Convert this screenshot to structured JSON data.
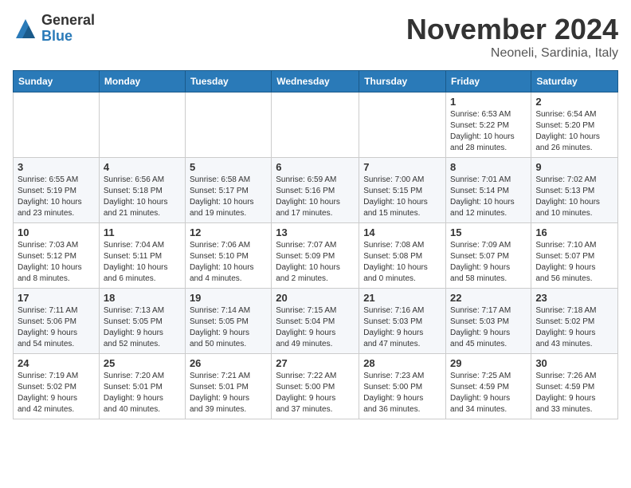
{
  "logo": {
    "general": "General",
    "blue": "Blue"
  },
  "title": "November 2024",
  "location": "Neoneli, Sardinia, Italy",
  "weekdays": [
    "Sunday",
    "Monday",
    "Tuesday",
    "Wednesday",
    "Thursday",
    "Friday",
    "Saturday"
  ],
  "weeks": [
    [
      {
        "day": "",
        "info": ""
      },
      {
        "day": "",
        "info": ""
      },
      {
        "day": "",
        "info": ""
      },
      {
        "day": "",
        "info": ""
      },
      {
        "day": "",
        "info": ""
      },
      {
        "day": "1",
        "info": "Sunrise: 6:53 AM\nSunset: 5:22 PM\nDaylight: 10 hours\nand 28 minutes."
      },
      {
        "day": "2",
        "info": "Sunrise: 6:54 AM\nSunset: 5:20 PM\nDaylight: 10 hours\nand 26 minutes."
      }
    ],
    [
      {
        "day": "3",
        "info": "Sunrise: 6:55 AM\nSunset: 5:19 PM\nDaylight: 10 hours\nand 23 minutes."
      },
      {
        "day": "4",
        "info": "Sunrise: 6:56 AM\nSunset: 5:18 PM\nDaylight: 10 hours\nand 21 minutes."
      },
      {
        "day": "5",
        "info": "Sunrise: 6:58 AM\nSunset: 5:17 PM\nDaylight: 10 hours\nand 19 minutes."
      },
      {
        "day": "6",
        "info": "Sunrise: 6:59 AM\nSunset: 5:16 PM\nDaylight: 10 hours\nand 17 minutes."
      },
      {
        "day": "7",
        "info": "Sunrise: 7:00 AM\nSunset: 5:15 PM\nDaylight: 10 hours\nand 15 minutes."
      },
      {
        "day": "8",
        "info": "Sunrise: 7:01 AM\nSunset: 5:14 PM\nDaylight: 10 hours\nand 12 minutes."
      },
      {
        "day": "9",
        "info": "Sunrise: 7:02 AM\nSunset: 5:13 PM\nDaylight: 10 hours\nand 10 minutes."
      }
    ],
    [
      {
        "day": "10",
        "info": "Sunrise: 7:03 AM\nSunset: 5:12 PM\nDaylight: 10 hours\nand 8 minutes."
      },
      {
        "day": "11",
        "info": "Sunrise: 7:04 AM\nSunset: 5:11 PM\nDaylight: 10 hours\nand 6 minutes."
      },
      {
        "day": "12",
        "info": "Sunrise: 7:06 AM\nSunset: 5:10 PM\nDaylight: 10 hours\nand 4 minutes."
      },
      {
        "day": "13",
        "info": "Sunrise: 7:07 AM\nSunset: 5:09 PM\nDaylight: 10 hours\nand 2 minutes."
      },
      {
        "day": "14",
        "info": "Sunrise: 7:08 AM\nSunset: 5:08 PM\nDaylight: 10 hours\nand 0 minutes."
      },
      {
        "day": "15",
        "info": "Sunrise: 7:09 AM\nSunset: 5:07 PM\nDaylight: 9 hours\nand 58 minutes."
      },
      {
        "day": "16",
        "info": "Sunrise: 7:10 AM\nSunset: 5:07 PM\nDaylight: 9 hours\nand 56 minutes."
      }
    ],
    [
      {
        "day": "17",
        "info": "Sunrise: 7:11 AM\nSunset: 5:06 PM\nDaylight: 9 hours\nand 54 minutes."
      },
      {
        "day": "18",
        "info": "Sunrise: 7:13 AM\nSunset: 5:05 PM\nDaylight: 9 hours\nand 52 minutes."
      },
      {
        "day": "19",
        "info": "Sunrise: 7:14 AM\nSunset: 5:05 PM\nDaylight: 9 hours\nand 50 minutes."
      },
      {
        "day": "20",
        "info": "Sunrise: 7:15 AM\nSunset: 5:04 PM\nDaylight: 9 hours\nand 49 minutes."
      },
      {
        "day": "21",
        "info": "Sunrise: 7:16 AM\nSunset: 5:03 PM\nDaylight: 9 hours\nand 47 minutes."
      },
      {
        "day": "22",
        "info": "Sunrise: 7:17 AM\nSunset: 5:03 PM\nDaylight: 9 hours\nand 45 minutes."
      },
      {
        "day": "23",
        "info": "Sunrise: 7:18 AM\nSunset: 5:02 PM\nDaylight: 9 hours\nand 43 minutes."
      }
    ],
    [
      {
        "day": "24",
        "info": "Sunrise: 7:19 AM\nSunset: 5:02 PM\nDaylight: 9 hours\nand 42 minutes."
      },
      {
        "day": "25",
        "info": "Sunrise: 7:20 AM\nSunset: 5:01 PM\nDaylight: 9 hours\nand 40 minutes."
      },
      {
        "day": "26",
        "info": "Sunrise: 7:21 AM\nSunset: 5:01 PM\nDaylight: 9 hours\nand 39 minutes."
      },
      {
        "day": "27",
        "info": "Sunrise: 7:22 AM\nSunset: 5:00 PM\nDaylight: 9 hours\nand 37 minutes."
      },
      {
        "day": "28",
        "info": "Sunrise: 7:23 AM\nSunset: 5:00 PM\nDaylight: 9 hours\nand 36 minutes."
      },
      {
        "day": "29",
        "info": "Sunrise: 7:25 AM\nSunset: 4:59 PM\nDaylight: 9 hours\nand 34 minutes."
      },
      {
        "day": "30",
        "info": "Sunrise: 7:26 AM\nSunset: 4:59 PM\nDaylight: 9 hours\nand 33 minutes."
      }
    ]
  ]
}
